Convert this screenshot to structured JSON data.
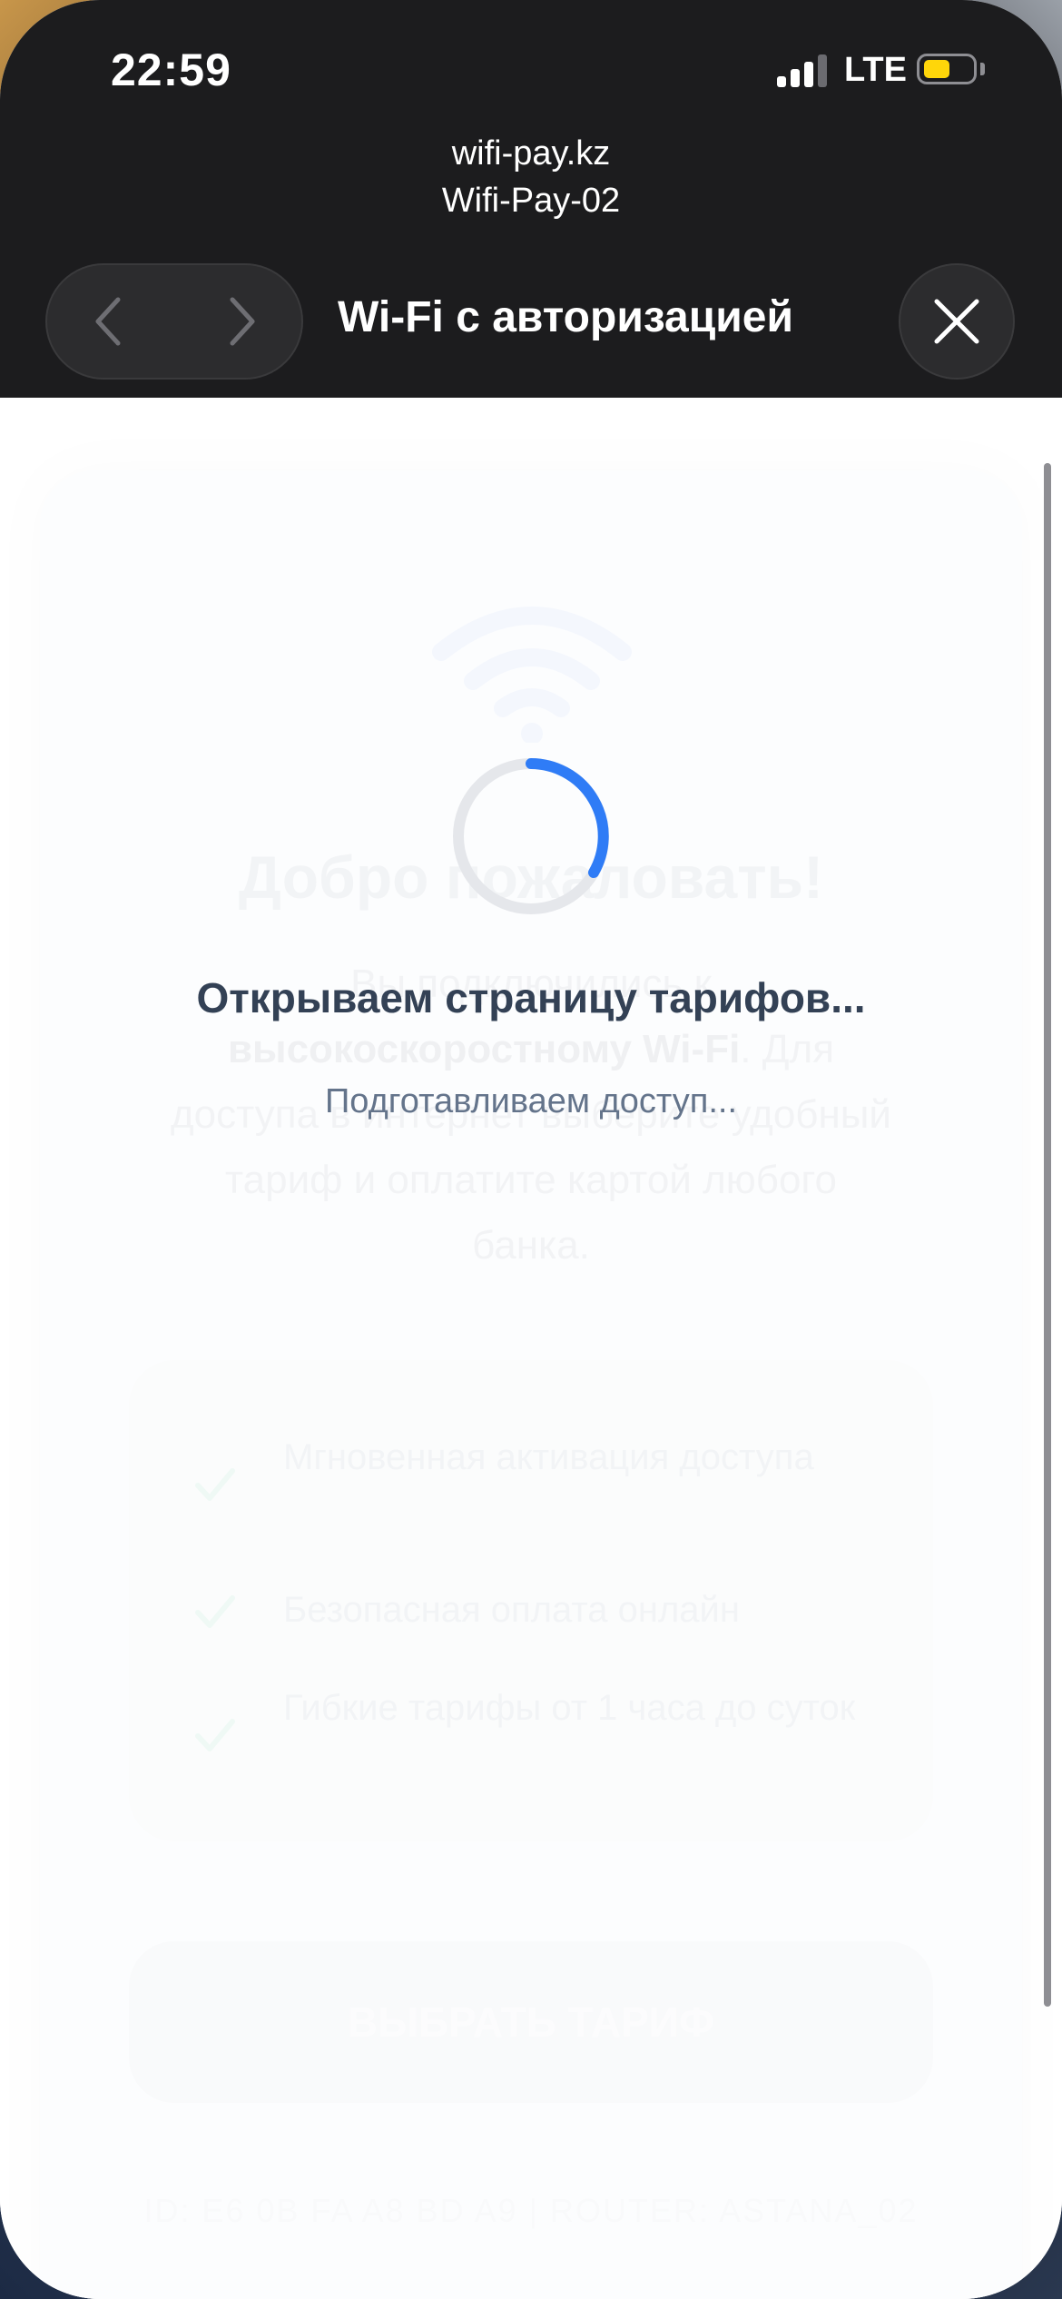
{
  "status_bar": {
    "time": "22:59",
    "network": "LTE",
    "battery_color": "#ffd60a"
  },
  "browser": {
    "host": "wifi-pay.kz",
    "network_name": "Wifi-Pay-02",
    "title": "Wi-Fi с авторизацией",
    "back_icon": "chevron-left-icon",
    "forward_icon": "chevron-right-icon",
    "close_icon": "close-icon"
  },
  "page": {
    "heading": "Добро пожаловать!",
    "desc_part1": "Вы подключились к ",
    "desc_bold": "высокоскоростному Wi-Fi",
    "desc_part2": ". Для доступа в интернет выберите удобный тариф и оплатите картой любого банка.",
    "features": [
      {
        "text": "Мгновенная активация доступа"
      },
      {
        "text": "Безопасная оплата онлайн"
      },
      {
        "text": "Гибкие тарифы от 1 часа до суток"
      }
    ],
    "choose_button": "ВЫБРАТЬ ТАРИФ",
    "footer": "ID: E6 0B FA A8 BD A9 | ROUTER: ASTANA_02"
  },
  "loading": {
    "title": "Открываем страницу тарифов...",
    "subtitle": "Подготавливаем доступ...",
    "accent_color": "#2f7cf6"
  }
}
